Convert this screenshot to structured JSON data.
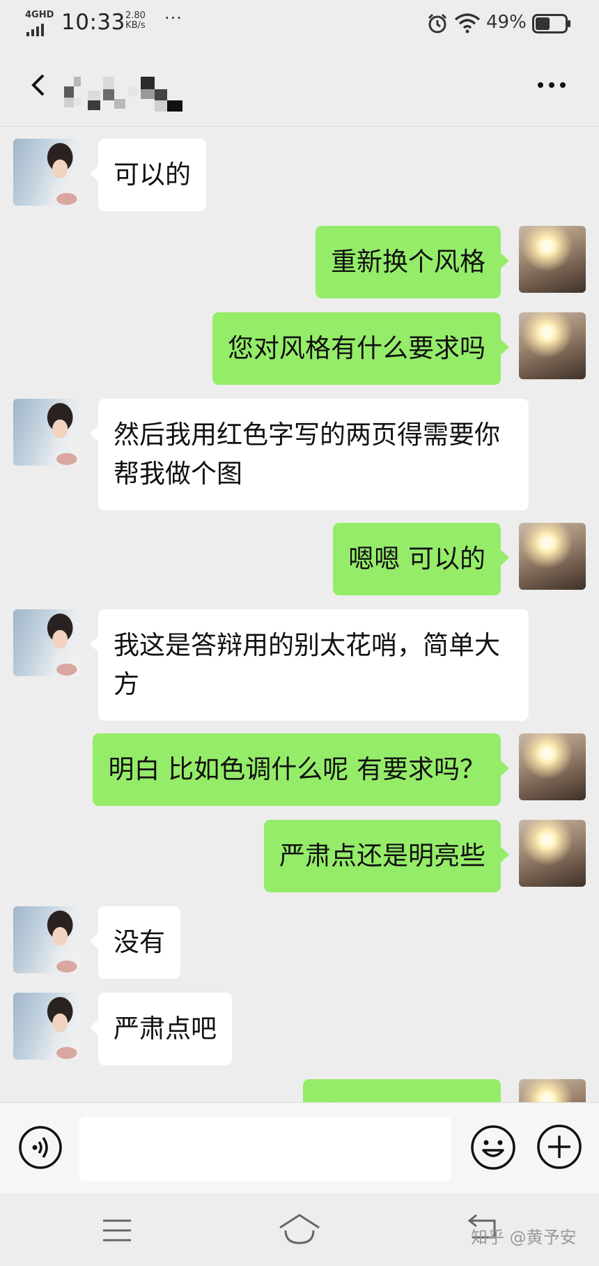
{
  "status_bar": {
    "network": "4GHD",
    "time": "10:33",
    "speed_value": "2.80",
    "speed_unit": "KB/s",
    "more": "···",
    "battery_pct": "49%",
    "battery_level": 0.49
  },
  "header": {
    "title_obscured": true,
    "menu_icon": "more-dots-icon"
  },
  "messages": [
    {
      "side": "in",
      "text": "可以的"
    },
    {
      "side": "out",
      "text": "重新换个风格"
    },
    {
      "side": "out",
      "text": "您对风格有什么要求吗"
    },
    {
      "side": "in",
      "text": "然后我用红色字写的两页得需要你帮我做个图"
    },
    {
      "side": "out",
      "text": "嗯嗯 可以的"
    },
    {
      "side": "in",
      "text": "我这是答辩用的别太花哨，简单大方"
    },
    {
      "side": "out",
      "text": "明白 比如色调什么呢 有要求吗？"
    },
    {
      "side": "out",
      "text": "严肃点还是明亮些"
    },
    {
      "side": "in",
      "text": "没有"
    },
    {
      "side": "in",
      "text": "严肃点吧"
    },
    {
      "side": "out",
      "text": "方便..."
    }
  ],
  "input_bar": {
    "voice_icon": "voice-icon",
    "input_value": "",
    "emoji_icon": "emoji-icon",
    "plus_icon": "plus-icon"
  },
  "nav_bar": {
    "watermark": "知乎 @黄予安"
  },
  "colors": {
    "background": "#ededed",
    "incoming_bubble": "#ffffff",
    "outgoing_bubble": "#95ec69"
  }
}
